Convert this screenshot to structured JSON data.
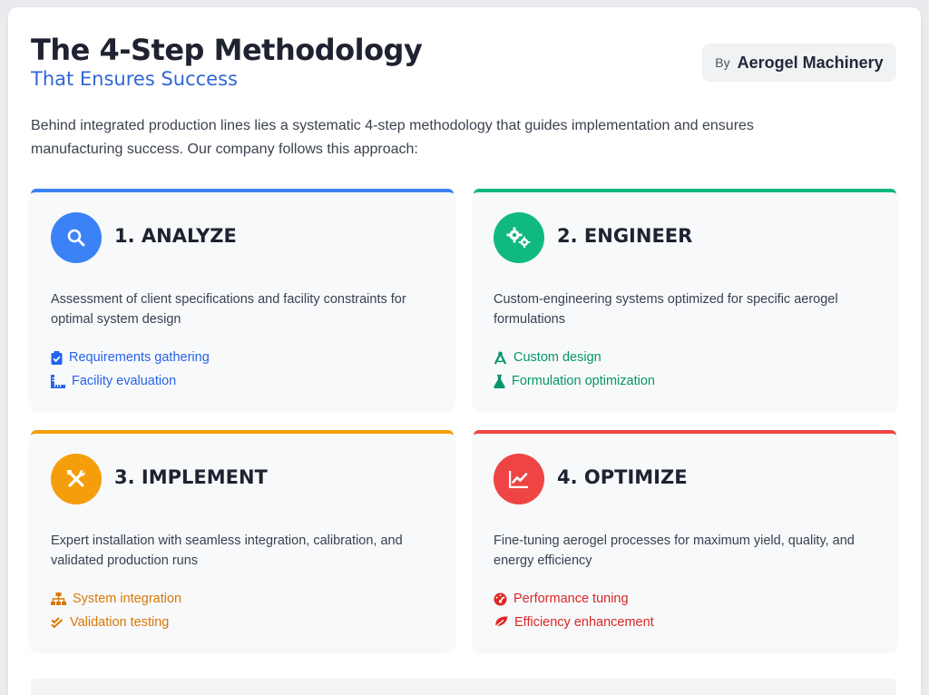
{
  "header": {
    "title": "The 4-Step Methodology",
    "subtitle": "That Ensures Success",
    "by_label": "By",
    "company": "Aerogel Machinery"
  },
  "intro": "Behind integrated production lines lies a systematic 4-step methodology that guides implementation and ensures manufacturing success. Our company follows this approach:",
  "steps": [
    {
      "title": "1. ANALYZE",
      "icon": "search-icon",
      "color": "#3b82f6",
      "description": "Assessment of client specifications and facility constraints for optimal system design",
      "features": [
        {
          "label": "Requirements gathering",
          "icon": "clipboard-check-icon"
        },
        {
          "label": "Facility evaluation",
          "icon": "ruler-combined-icon"
        }
      ]
    },
    {
      "title": "2. ENGINEER",
      "icon": "cogs-icon",
      "color": "#10b981",
      "description": "Custom-engineering systems optimized for specific aerogel formulations",
      "features": [
        {
          "label": "Custom design",
          "icon": "drafting-compass-icon"
        },
        {
          "label": "Formulation optimization",
          "icon": "flask-icon"
        }
      ]
    },
    {
      "title": "3. IMPLEMENT",
      "icon": "tools-icon",
      "color": "#f59e0b",
      "description": "Expert installation with seamless integration, calibration, and validated production runs",
      "features": [
        {
          "label": "System integration",
          "icon": "sitemap-icon"
        },
        {
          "label": "Validation testing",
          "icon": "check-double-icon"
        }
      ]
    },
    {
      "title": "4. OPTIMIZE",
      "icon": "chart-line-icon",
      "color": "#ef4444",
      "description": "Fine-tuning aerogel processes for maximum yield, quality, and energy efficiency",
      "features": [
        {
          "label": "Performance tuning",
          "icon": "tachometer-icon"
        },
        {
          "label": "Efficiency enhancement",
          "icon": "leaf-icon"
        }
      ]
    }
  ],
  "feature_text_colors": [
    "#2563eb",
    "#059669",
    "#d97706",
    "#dc2626"
  ]
}
